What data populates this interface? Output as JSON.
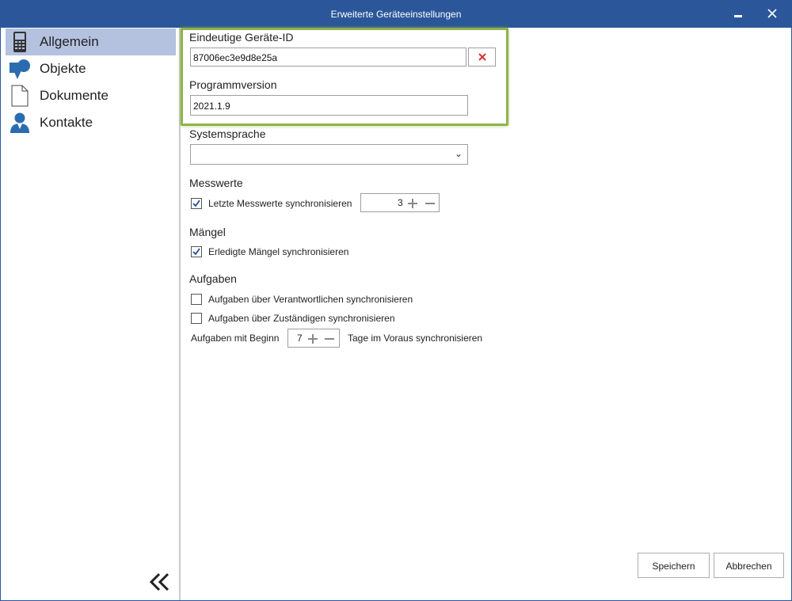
{
  "window": {
    "title": "Erweiterte Geräteeinstellungen",
    "accent_color": "#2b579a",
    "highlight_color": "#8fb34a"
  },
  "sidebar": {
    "items": [
      {
        "label": "Allgemein",
        "icon": "device-icon",
        "active": true
      },
      {
        "label": "Objekte",
        "icon": "objects-icon",
        "active": false
      },
      {
        "label": "Dokumente",
        "icon": "document-icon",
        "active": false
      },
      {
        "label": "Kontakte",
        "icon": "contact-icon",
        "active": false
      }
    ],
    "collapse_icon": "double-chevron-left-icon",
    "active_color": "#b4c2e0"
  },
  "form": {
    "device_id": {
      "label": "Eindeutige Geräte-ID",
      "value": "87006ec3e9d8e25a"
    },
    "program_version": {
      "label": "Programmversion",
      "value": "2021.1.9"
    },
    "system_language": {
      "label": "Systemsprache",
      "value": ""
    },
    "measurements": {
      "label": "Messwerte",
      "checkbox_label": "Letzte Messwerte synchronisieren",
      "checked": true,
      "count": "3"
    },
    "defects": {
      "label": "Mängel",
      "checkbox_label": "Erledigte Mängel synchronisieren",
      "checked": true
    },
    "tasks": {
      "label": "Aufgaben",
      "option1": {
        "label": "Aufgaben über Verantwortlichen synchronisieren",
        "checked": false
      },
      "option2": {
        "label": "Aufgaben über Zuständigen synchronisieren",
        "checked": false
      },
      "days_prefix": "Aufgaben mit Beginn",
      "days_value": "7",
      "days_suffix": "Tage im Voraus synchronisieren"
    }
  },
  "footer": {
    "save_label": "Speichern",
    "cancel_label": "Abbrechen"
  }
}
